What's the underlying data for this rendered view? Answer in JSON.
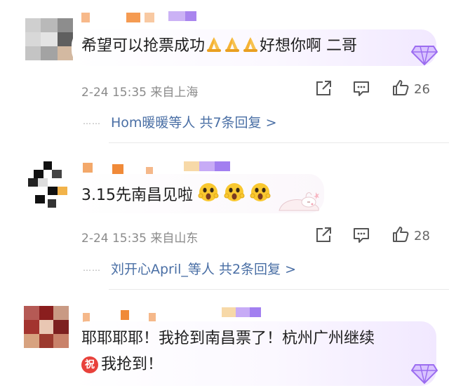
{
  "colors": {
    "link": "#4a6fa5",
    "meta": "#8a8a8a",
    "badge_purple": "#b07cf2"
  },
  "comments": [
    {
      "text": "希望可以抢票成功",
      "text_after": "好想你啊 二哥",
      "emoji": [
        "praying-hands",
        "praying-hands",
        "praying-hands"
      ],
      "date": "2-24 15:35",
      "location": "来自上海",
      "likes": "26",
      "replies_label": "Hom暖暖等人 共7条回复 >"
    },
    {
      "text": "3.15先南昌见啦",
      "emoji": [
        "shocked-face",
        "shocked-face",
        "shocked-face"
      ],
      "sticker": "sleeping-bunny",
      "date": "2-24 15:35",
      "location": "来自山东",
      "likes": "28",
      "replies_label": "刘开心April_等人 共2条回复 >"
    },
    {
      "text": "耶耶耶耶！我抢到南昌票了！杭州广州继续",
      "badge_char": "祝",
      "text2": "我抢到！"
    }
  ]
}
